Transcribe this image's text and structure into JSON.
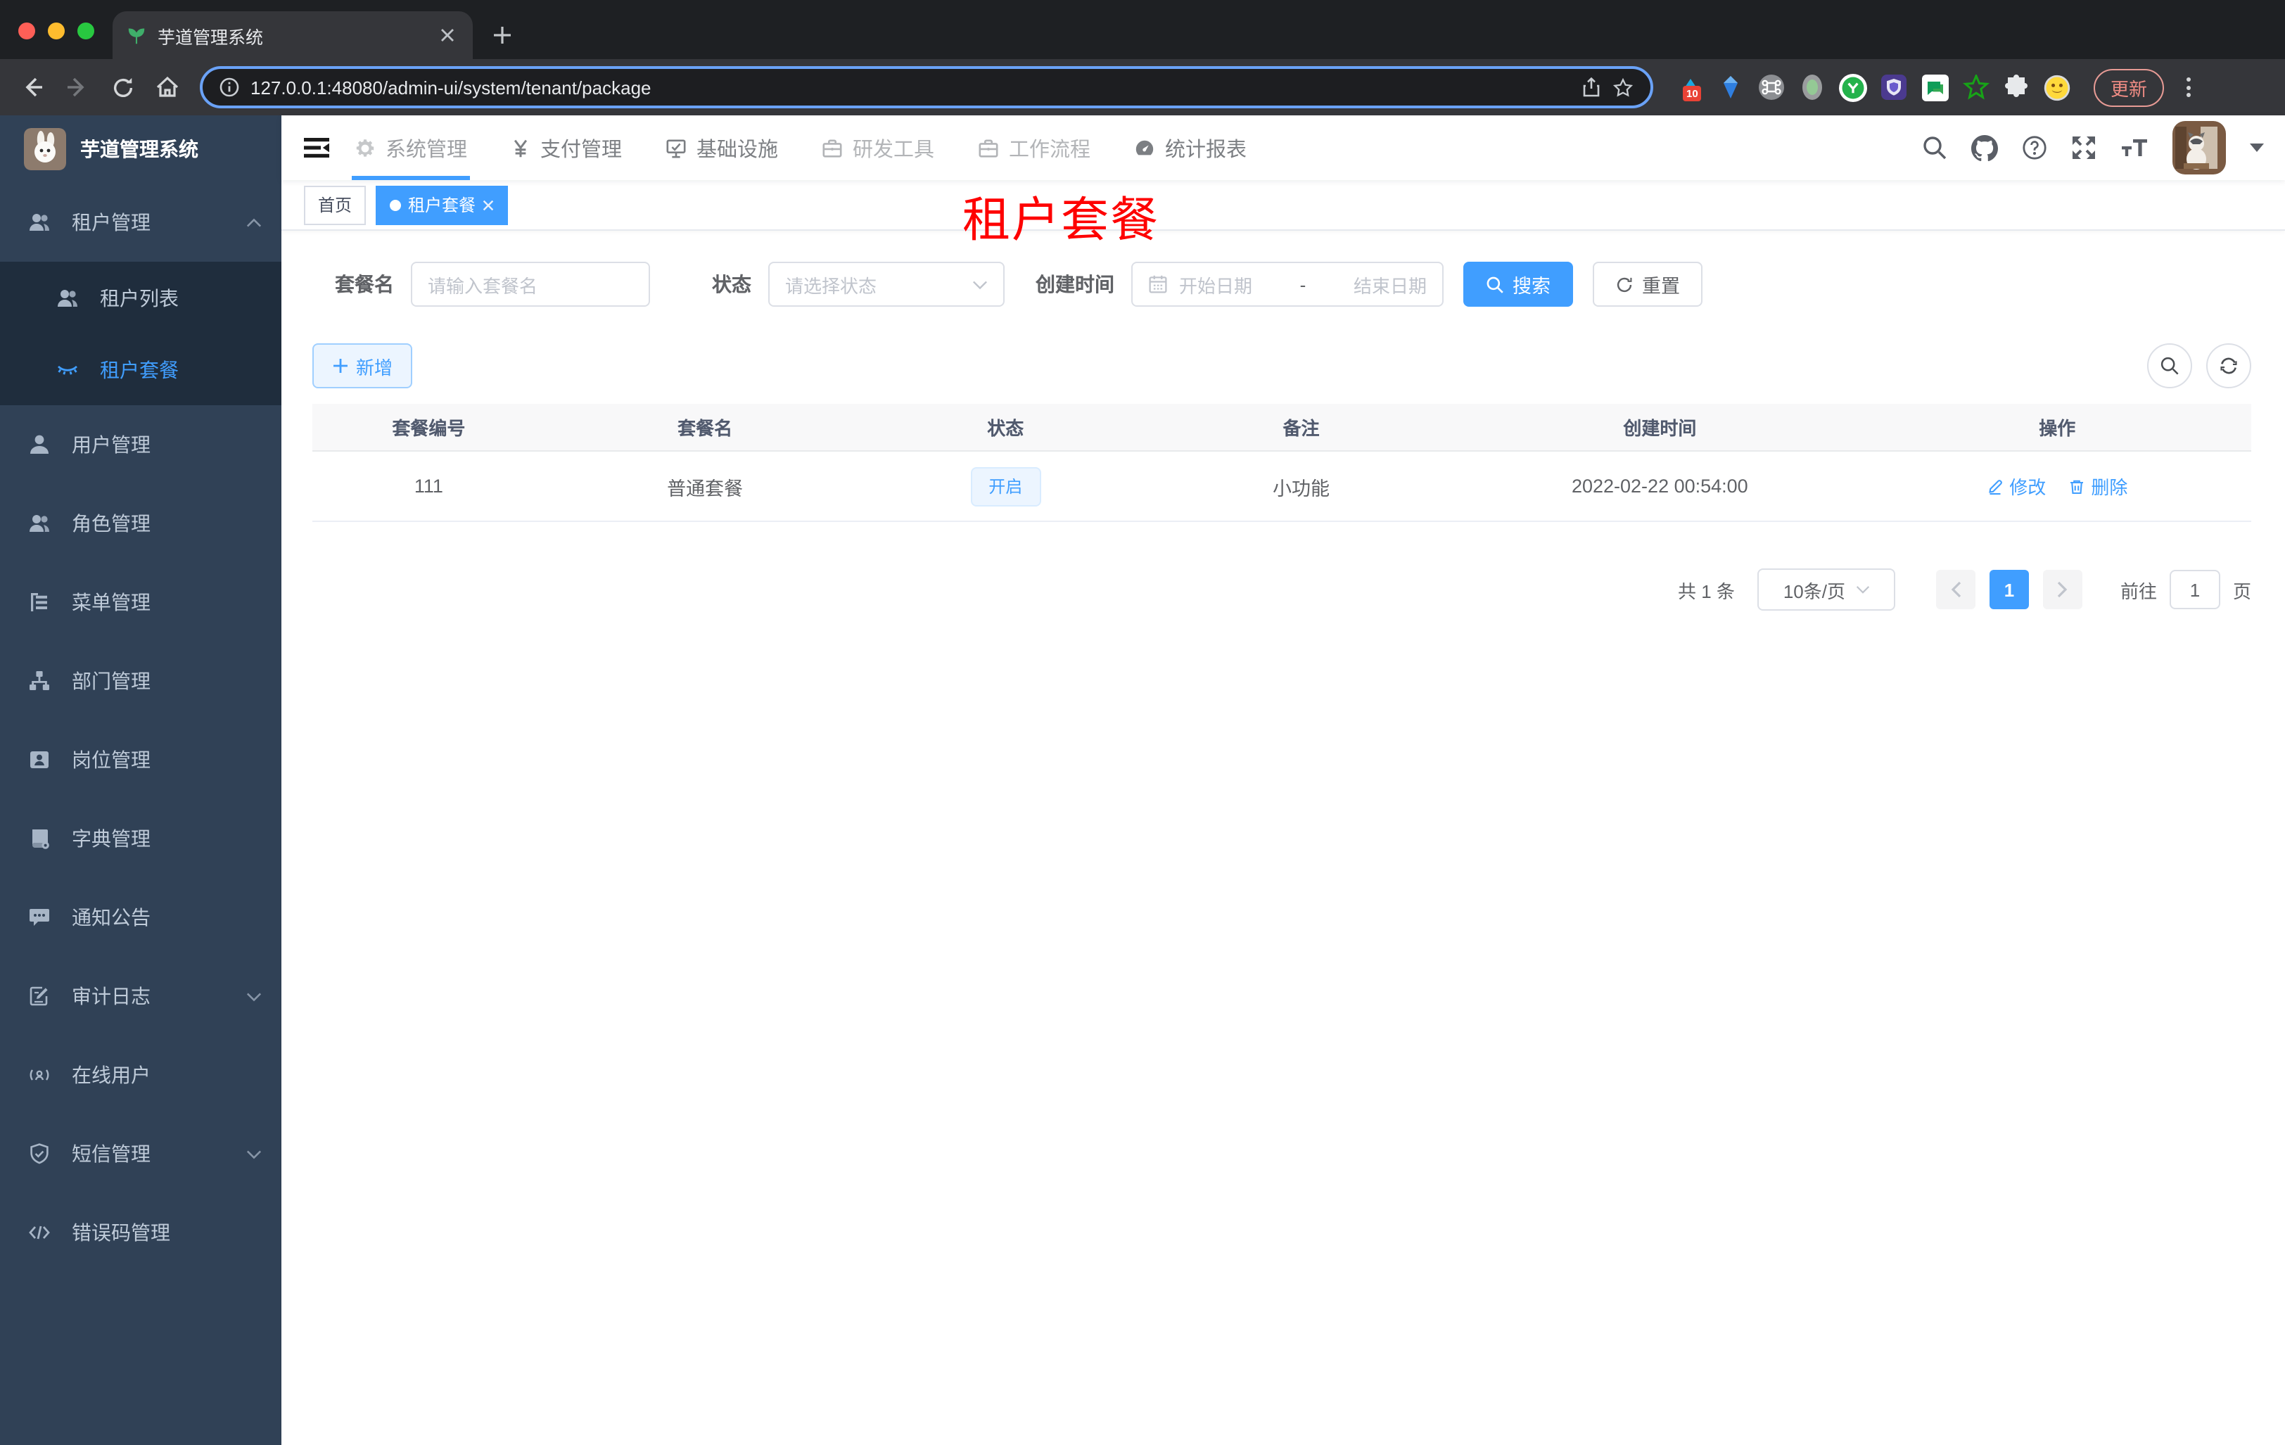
{
  "colors": {
    "accent": "#409eff",
    "sidebar_bg": "#304156",
    "submenu_bg": "#1f2d3d",
    "watermark_red": "#fe0000",
    "tag_active": "#409eff"
  },
  "browser": {
    "tab_title": "芋道管理系统",
    "url": "127.0.0.1:48080/admin-ui/system/tenant/package",
    "update_label": "更新",
    "extensions_badge": "10"
  },
  "sidebar": {
    "title": "芋道管理系统",
    "menu": [
      {
        "label": "租户管理",
        "icon": "peoples-icon",
        "expanded": true,
        "children": [
          {
            "label": "租户列表",
            "icon": "peoples-icon",
            "active": false
          },
          {
            "label": "租户套餐",
            "icon": "tenant-package-icon",
            "active": true
          }
        ]
      },
      {
        "label": "用户管理",
        "icon": "user-icon"
      },
      {
        "label": "角色管理",
        "icon": "peoples-icon"
      },
      {
        "label": "菜单管理",
        "icon": "tree-table-icon"
      },
      {
        "label": "部门管理",
        "icon": "org-tree-icon"
      },
      {
        "label": "岗位管理",
        "icon": "post-icon"
      },
      {
        "label": "字典管理",
        "icon": "dict-icon"
      },
      {
        "label": "通知公告",
        "icon": "message-icon"
      },
      {
        "label": "审计日志",
        "icon": "log-icon",
        "collapsible": true
      },
      {
        "label": "在线用户",
        "icon": "online-icon"
      },
      {
        "label": "短信管理",
        "icon": "sms-shield-icon",
        "collapsible": true
      },
      {
        "label": "错误码管理",
        "icon": "code-icon"
      }
    ]
  },
  "topnav": {
    "items": [
      {
        "label": "系统管理",
        "icon": "gear-icon",
        "active": true
      },
      {
        "label": "支付管理",
        "icon": "yen-icon"
      },
      {
        "label": "基础设施",
        "icon": "monitor-icon"
      },
      {
        "label": "研发工具",
        "icon": "briefcase-icon"
      },
      {
        "label": "工作流程",
        "icon": "briefcase-icon"
      },
      {
        "label": "统计报表",
        "icon": "dashboard-icon"
      }
    ]
  },
  "tags": [
    {
      "label": "首页",
      "active": false
    },
    {
      "label": "租户套餐",
      "active": true,
      "closable": true
    }
  ],
  "watermark": "租户套餐",
  "filters": {
    "name_label": "套餐名",
    "name_placeholder": "请输入套餐名",
    "status_label": "状态",
    "status_placeholder": "请选择状态",
    "date_label": "创建时间",
    "date_start_placeholder": "开始日期",
    "date_separator": "-",
    "date_end_placeholder": "结束日期",
    "search_label": "搜索",
    "reset_label": "重置"
  },
  "toolbar": {
    "add_label": "新增"
  },
  "table": {
    "columns": [
      "套餐编号",
      "套餐名",
      "状态",
      "备注",
      "创建时间",
      "操作"
    ],
    "rows": [
      {
        "id": "111",
        "name": "普通套餐",
        "status": "开启",
        "remark": "小功能",
        "create_time": "2022-02-22 00:54:00",
        "actions": [
          {
            "label": "修改"
          },
          {
            "label": "删除"
          }
        ]
      }
    ]
  },
  "pagination": {
    "total_text": "共 1 条",
    "page_size": "10条/页",
    "current": "1",
    "goto_label": "前往",
    "goto_value": "1",
    "page_label": "页"
  }
}
